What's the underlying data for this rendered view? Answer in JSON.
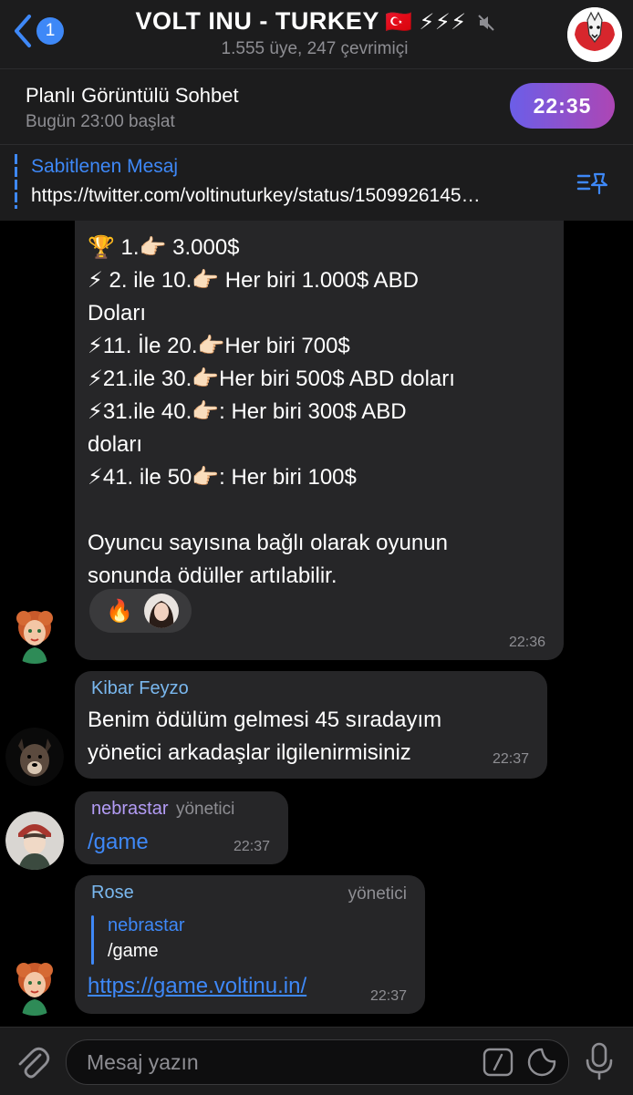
{
  "header": {
    "back_badge": "1",
    "title": "VOLT INU - TURKEY",
    "title_extra": "🇹🇷 ⚡⚡⚡",
    "subtitle": "1.555 üye, 247 çevrimiçi"
  },
  "call": {
    "title": "Planlı Görüntülü Sohbet",
    "subtitle": "Bugün 23:00 başlat",
    "countdown": "22:35"
  },
  "pinned": {
    "title": "Sabitlenen Mesaj",
    "text": "https://twitter.com/voltinuturkey/status/1509926145…"
  },
  "messages": {
    "m1": {
      "lines": [
        "🏆 1.👉🏻 3.000$",
        "⚡ 2. ile 10.👉🏻 Her biri 1.000$ ABD",
        "Doları",
        "⚡11. İle 20.👉🏻Her biri 700$",
        "⚡21.ile 30.👉🏻Her biri 500$ ABD doları",
        "⚡31.ile 40.👉🏻: Her biri 300$ ABD",
        "doları",
        "⚡41. ile 50👉🏻: Her biri 100$",
        "",
        "Oyuncu sayısına bağlı olarak oyunun",
        "sonunda ödüller artılabilir."
      ],
      "reaction": "🔥",
      "time": "22:36"
    },
    "m2": {
      "sender": "Kibar Feyzo",
      "lines": [
        "Benim ödülüm gelmesi 45 sıradayım",
        "yönetici arkadaşlar ilgilenirmisiniz"
      ],
      "time": "22:37"
    },
    "m3": {
      "sender": "nebrastar",
      "role": "yönetici",
      "text": "/game",
      "time": "22:37"
    },
    "m4": {
      "sender": "Rose",
      "role": "yönetici",
      "reply_sender": "nebrastar",
      "reply_text": "/game",
      "link": "https://game.voltinu.in/",
      "time": "22:37"
    }
  },
  "input": {
    "placeholder": "Mesaj yazın"
  },
  "colors": {
    "accent": "#3e88f7",
    "bubble": "#262628",
    "admin_name": "#b39cf5",
    "name_blue": "#7ab8ef"
  }
}
